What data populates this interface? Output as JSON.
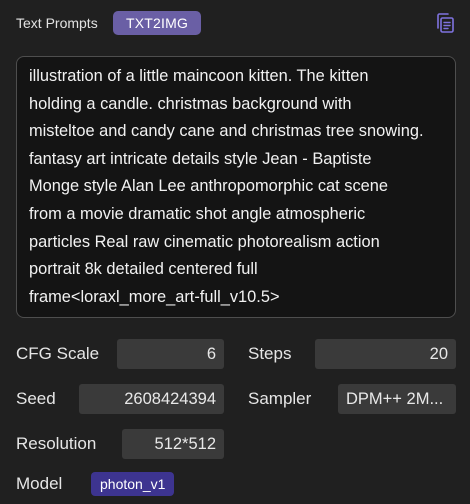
{
  "header": {
    "title": "Text Prompts",
    "mode_tag": "TXT2IMG",
    "copy_icon": "copy-icon"
  },
  "prompt": {
    "text": "illustration of a little maincoon kitten. The kitten\nholding a candle. christmas background with\nmisteltoe and candy cane and christmas tree snowing.\nfantasy art intricate details style Jean - Baptiste\nMonge style Alan Lee anthropomorphic cat scene\nfrom a movie dramatic shot angle atmospheric\nparticles Real raw cinematic photorealism action\nportrait 8k detailed centered full\nframe<loraxl_more_art-full_v10.5>"
  },
  "params": {
    "cfg_scale": {
      "label": "CFG Scale",
      "value": "6"
    },
    "steps": {
      "label": "Steps",
      "value": "20"
    },
    "seed": {
      "label": "Seed",
      "value": "2608424394"
    },
    "sampler": {
      "label": "Sampler",
      "value": "DPM++ 2M..."
    },
    "resolution": {
      "label": "Resolution",
      "value": "512*512"
    },
    "model": {
      "label": "Model",
      "value": "photon_v1"
    }
  },
  "colors": {
    "background": "#202020",
    "mode_tag": "#6a5fa5",
    "model_tag": "#3d3490",
    "copy_icon": "#7f73e0",
    "field": "#3a3a3a"
  }
}
